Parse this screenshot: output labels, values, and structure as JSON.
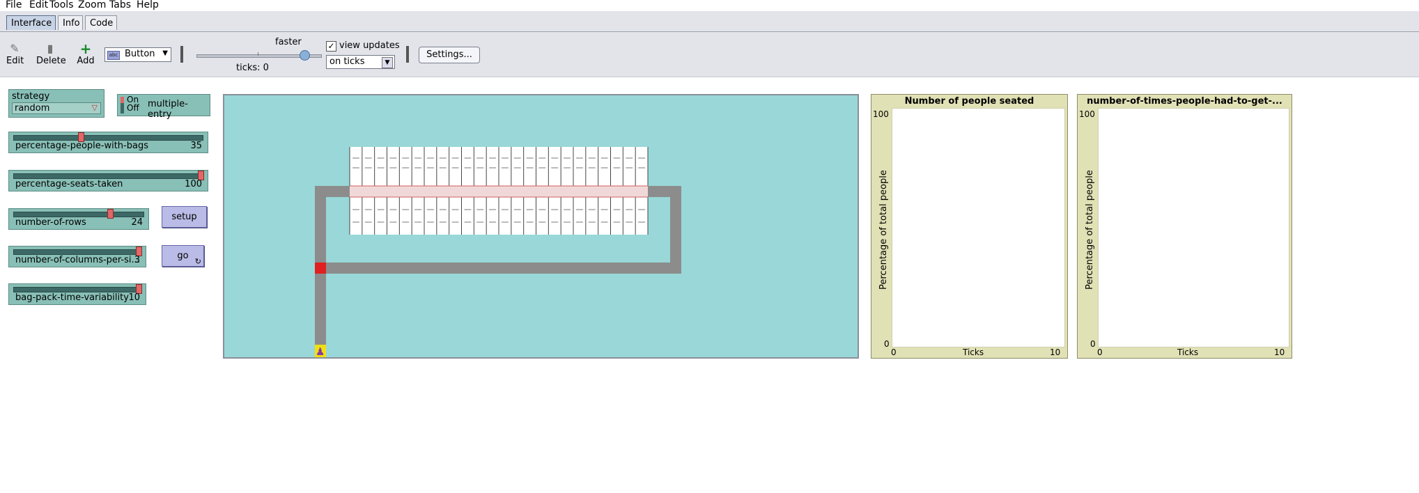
{
  "menu": [
    "File",
    "Edit",
    "Tools",
    "Zoom",
    "Tabs",
    "Help"
  ],
  "tabs": [
    "Interface",
    "Info",
    "Code"
  ],
  "toolbar": {
    "edit_label": "Edit",
    "delete_label": "Delete",
    "add_label": "Add",
    "widget_type": "Button",
    "widget_type_icon": "abc",
    "speed_label": "faster",
    "ticks_label": "ticks: 0",
    "view_updates_label": "view updates",
    "view_updates_checked": true,
    "view_updates_check": "✓",
    "update_mode": "on ticks",
    "settings_label": "Settings..."
  },
  "widgets": {
    "strategy": {
      "label": "strategy",
      "value": "random"
    },
    "multiple_entry": {
      "on": "On",
      "off": "Off",
      "label": "multiple-entry"
    },
    "sliders": [
      {
        "name": "percentage-people-with-bags",
        "value": "35",
        "level": 0.35
      },
      {
        "name": "percentage-seats-taken",
        "value": "100",
        "level": 1.0
      },
      {
        "name": "number-of-rows",
        "value": "24",
        "level": 0.75
      },
      {
        "name": "number-of-columns-per-si...",
        "value": "3",
        "level": 1.0
      },
      {
        "name": "bag-pack-time-variability",
        "value": "10",
        "level": 1.0
      }
    ],
    "setup_label": "setup",
    "go_label": "go",
    "go_icon": "forever-icon"
  },
  "plots": [
    {
      "title": "Number of people seated",
      "ylabel": "Percentage of total people",
      "xlabel": "Ticks",
      "xmin": "0",
      "xmax": "10",
      "ymin": "0",
      "ymax": "100"
    },
    {
      "title": "number-of-times-people-had-to-get-...",
      "ylabel": "Percentage of total people",
      "xlabel": "Ticks",
      "xmin": "0",
      "xmax": "10",
      "ymin": "0",
      "ymax": "100"
    }
  ],
  "colors": {
    "world_background": "#99d7d8",
    "aisle": "#8c8c8c",
    "seat": "#ffffff",
    "entry": "#e02020",
    "agent": "#f0e010"
  }
}
